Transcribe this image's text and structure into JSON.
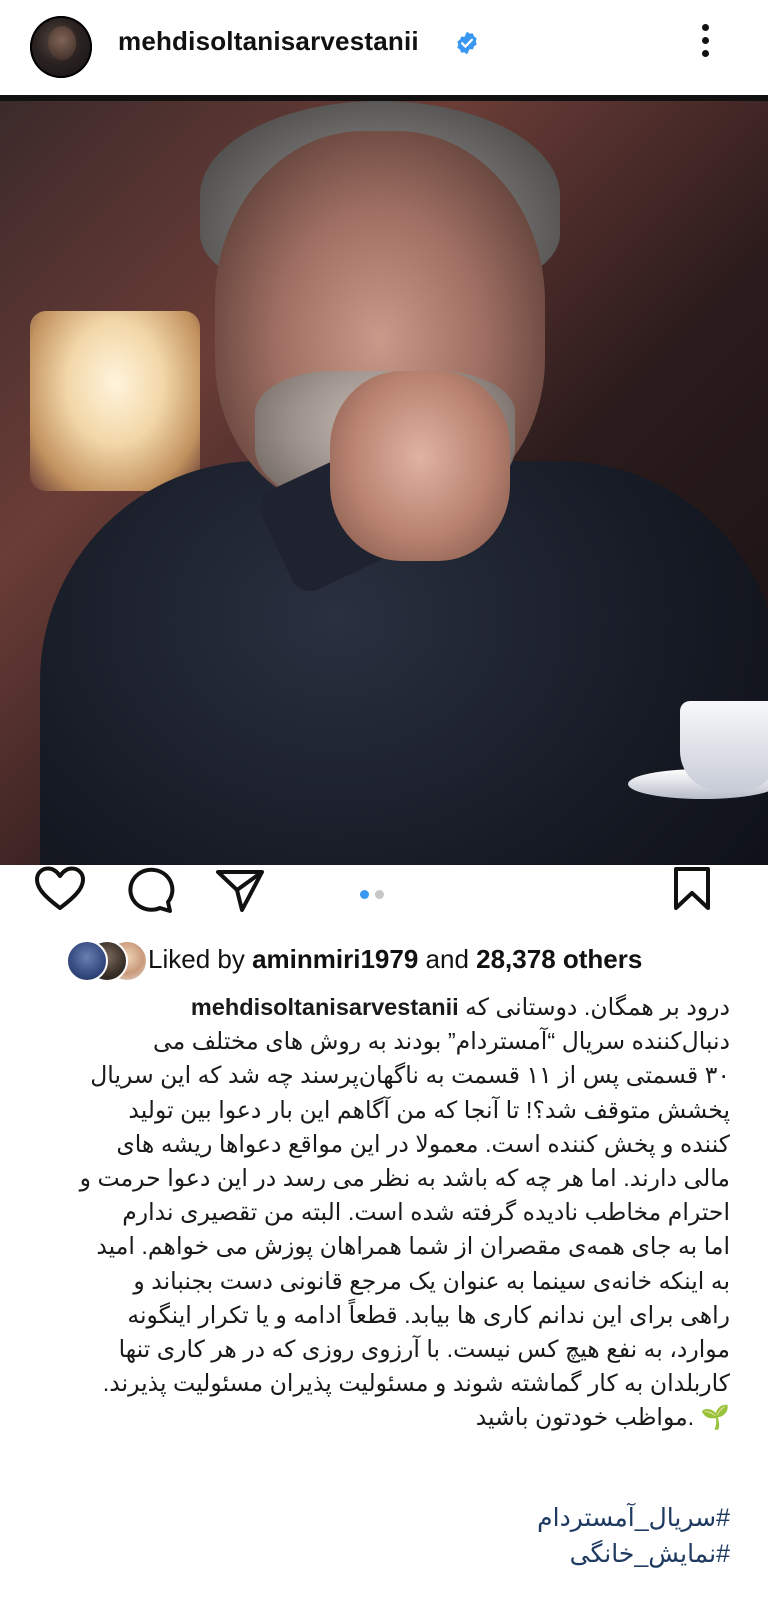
{
  "header": {
    "username": "mehdisoltanisarvestanii",
    "verified_icon": "verified-badge-icon",
    "more_icon": "more-options-icon"
  },
  "post": {
    "image_alt": "portrait-photo",
    "carousel": {
      "current": 1,
      "total": 2
    }
  },
  "actions": {
    "like_icon": "heart-icon",
    "comment_icon": "comment-icon",
    "share_icon": "share-icon",
    "save_icon": "bookmark-icon"
  },
  "likes": {
    "prefix": "Liked by ",
    "user": "aminmiri1979",
    "middle": " and ",
    "count": "28,378 others"
  },
  "caption": {
    "username": "mehdisoltanisarvestanii",
    "first_line_text": "درود بر همگان. دوستانی که ",
    "lines": [
      "دنبال‌کننده سریال “آمستردام” بودند به روش های مختلف می",
      "۳۰ قسمتی  پس از ۱۱ قسمت به ناگهان‌پرسند چه شد که این سریال",
      "پخشش متوقف شد؟! تا آنجا که من آگاهم این بار دعوا بین تولید",
      "کننده و پخش کننده است. معمولا در این مواقع دعواها ریشه های",
      "مالی دارند. اما هر چه که باشد به نظر می رسد در این دعوا حرمت و",
      "احترام مخاطب نادیده گرفته شده است.  البته من تقصیری ندارم",
      "اما به جای همه‌ی مقصران از شما همراهان پوزش می خواهم. امید",
      "به اینکه خانه‌ی سینما به عنوان یک مرجع قانونی دست بجنباند و",
      "راهی برای این ندانم کاری ها بیابد. قطعاً ادامه و یا تکرار اینگونه",
      "موارد، به نفع هیچ کس نیست.  با آرزوی روزی که در هر کاری تنها",
      "کاربلدان  به کار گماشته شوند و مسئولیت پذیران مسئولیت پذیرند.",
      "🌱 .مواظب خودتون باشید"
    ],
    "hashtags": [
      "#سریال_آمستردام",
      "#نمایش_خانگی"
    ]
  },
  "colors": {
    "verified": "#3897f0",
    "dot_active": "#3897f0",
    "dot_inactive": "#c7c7c7",
    "hashtag": "#1f3a60"
  }
}
